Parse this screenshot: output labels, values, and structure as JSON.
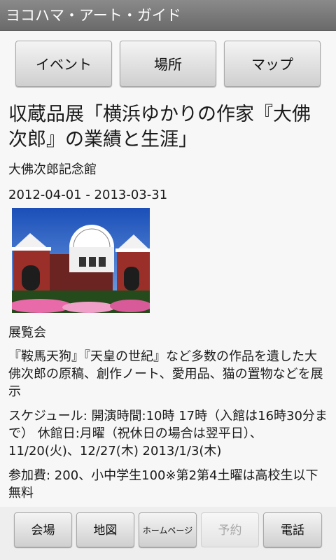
{
  "app": {
    "title": "ヨコハマ・アート・ガイド"
  },
  "nav": {
    "event": "イベント",
    "place": "場所",
    "map": "マップ"
  },
  "event": {
    "title": "収蔵品展「横浜ゆかりの作家『大佛次郎』の業績と生涯」",
    "venue": "大佛次郎記念館",
    "dates": "2012-04-01 - 2013-03-31",
    "category": "展覧会",
    "description": "『鞍馬天狗』『天皇の世紀』など多数の作品を遺した大佛次郎の原稿、創作ノート、愛用品、猫の置物などを展示",
    "schedule": "スケジュール: 開演時間:10時 17時（入館は16時30分まで） 休館日:月曜（祝休日の場合は翌平日）、11/20(火)、12/27(木) 2013/1/3(木)",
    "fee": "参加費: 200、小中学生100※第2第4土曜は高校生以下無料"
  },
  "actions": {
    "venue": "会場",
    "map": "地図",
    "homepage": "ホームページ",
    "reserve": "予約",
    "phone": "電話"
  }
}
